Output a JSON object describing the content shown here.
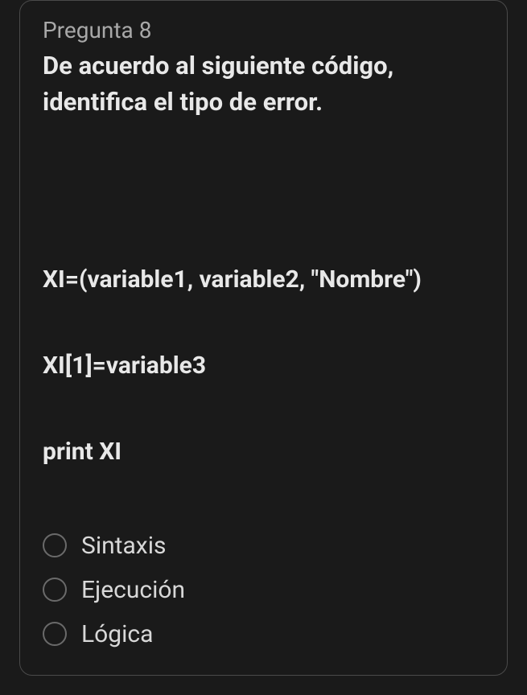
{
  "question": {
    "label": "Pregunta 8",
    "title": "De acuerdo al siguiente código, identifica el tipo de error."
  },
  "code": {
    "line1": "XI=(variable1, variable2, \"Nombre\")",
    "line2": "XI[1]=variable3",
    "line3": "print XI"
  },
  "options": [
    {
      "label": "Sintaxis"
    },
    {
      "label": "Ejecución"
    },
    {
      "label": "Lógica"
    }
  ]
}
